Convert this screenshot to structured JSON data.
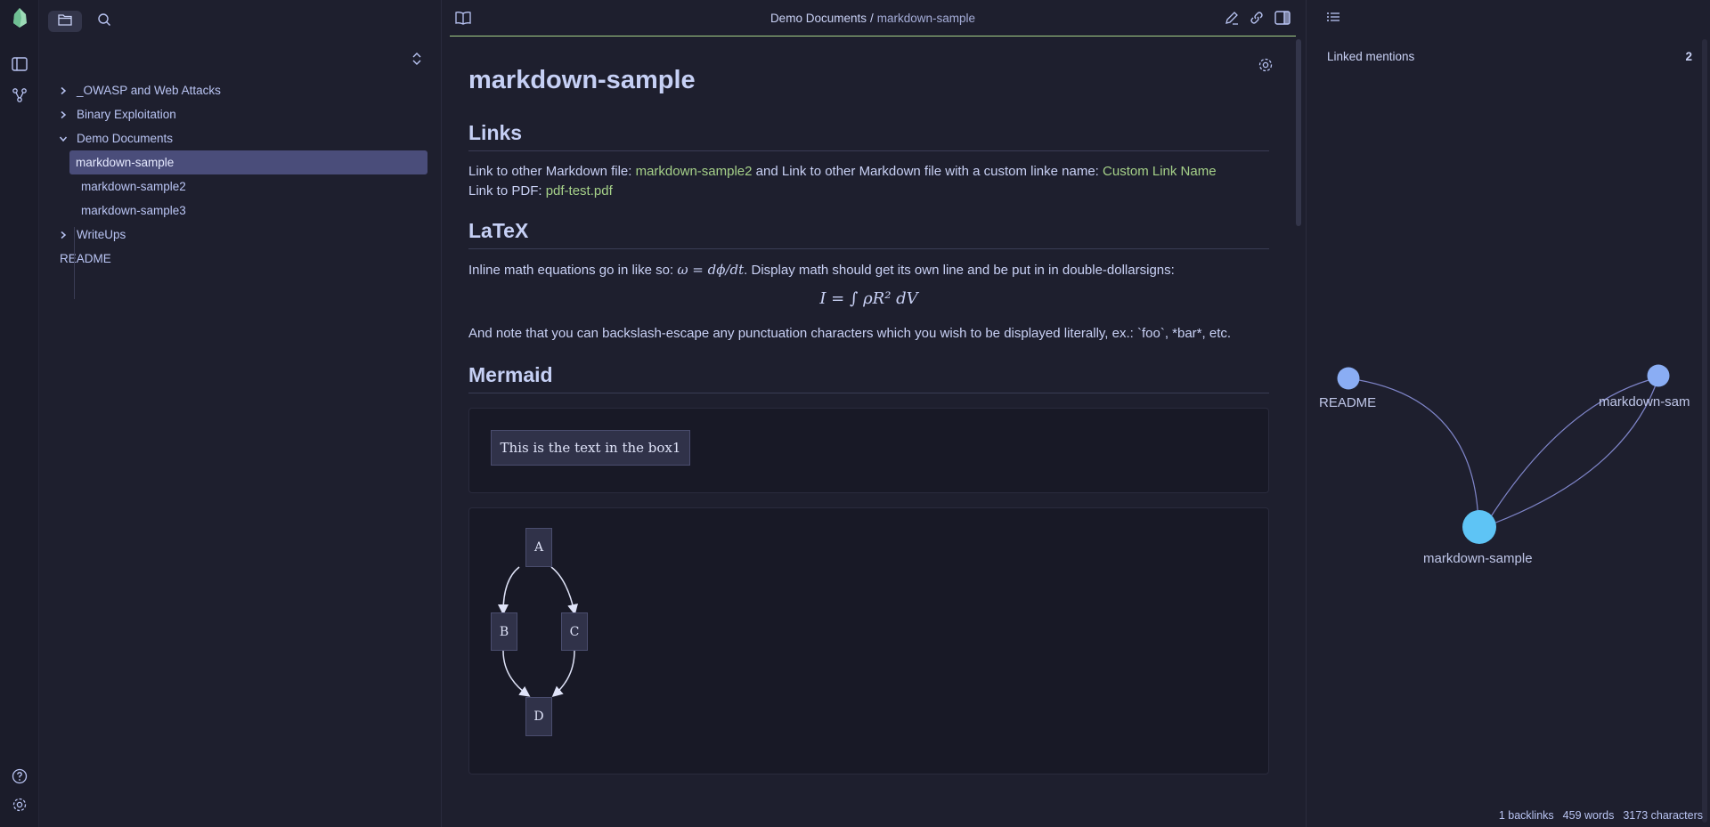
{
  "ribbon": {
    "logo": "obsidian-logo-icon",
    "icons": [
      "sidebar-toggle-icon",
      "graph-view-icon"
    ],
    "bottom_icons": [
      "help-icon",
      "settings-icon"
    ]
  },
  "sidebar": {
    "tabs": [
      "files-icon",
      "search-icon"
    ],
    "tree": [
      {
        "label": "_OWASP and Web Attacks",
        "type": "folder",
        "expanded": false
      },
      {
        "label": "Binary Exploitation",
        "type": "folder",
        "expanded": false
      },
      {
        "label": "Demo Documents",
        "type": "folder",
        "expanded": true
      },
      {
        "label": "markdown-sample",
        "type": "file",
        "active": true
      },
      {
        "label": "markdown-sample2",
        "type": "file"
      },
      {
        "label": "markdown-sample3",
        "type": "file"
      },
      {
        "label": "WriteUps",
        "type": "folder",
        "expanded": false
      },
      {
        "label": "README",
        "type": "file"
      }
    ]
  },
  "editor": {
    "breadcrumb": {
      "parent": "Demo Documents",
      "separator": "/",
      "current": "markdown-sample"
    },
    "title": "markdown-sample",
    "sections": {
      "links": {
        "heading": "Links",
        "line1_prefix": "Link to other Markdown file: ",
        "line1_link1": "markdown-sample2",
        "line1_mid": " and Link to other Markdown file with a custom linke name: ",
        "line1_link2": "Custom Link Name",
        "line2_prefix": "Link to PDF: ",
        "line2_link": "pdf-test.pdf"
      },
      "latex": {
        "heading": "LaTeX",
        "p1_prefix": "Inline math equations go in like so: ",
        "p1_math": "ω = dϕ/dt",
        "p1_suffix": ". Display math should get its own line and be put in in double-dollarsigns:",
        "display_math": "I = ∫ ρR² dV",
        "p2": "And note that you can backslash-escape any punctuation characters which you wish to be displayed literally, ex.: `foo`, *bar*, etc."
      },
      "mermaid": {
        "heading": "Mermaid",
        "box1_text": "This is the text in the box1",
        "graph_nodes": [
          "A",
          "B",
          "C",
          "D"
        ]
      }
    }
  },
  "rightpane": {
    "linked_mentions_label": "Linked mentions",
    "linked_mentions_count": "2",
    "graph_nodes": [
      "README",
      "markdown-sam",
      "markdown-sample"
    ]
  },
  "statusbar": {
    "backlinks": "1 backlinks",
    "words": "459 words",
    "characters": "3173 characters"
  },
  "colors": {
    "accent_link": "#a6d189",
    "active_item": "#4a4d7a",
    "graph_node": "#8aadf4",
    "graph_node_current": "#5ec4f5"
  }
}
